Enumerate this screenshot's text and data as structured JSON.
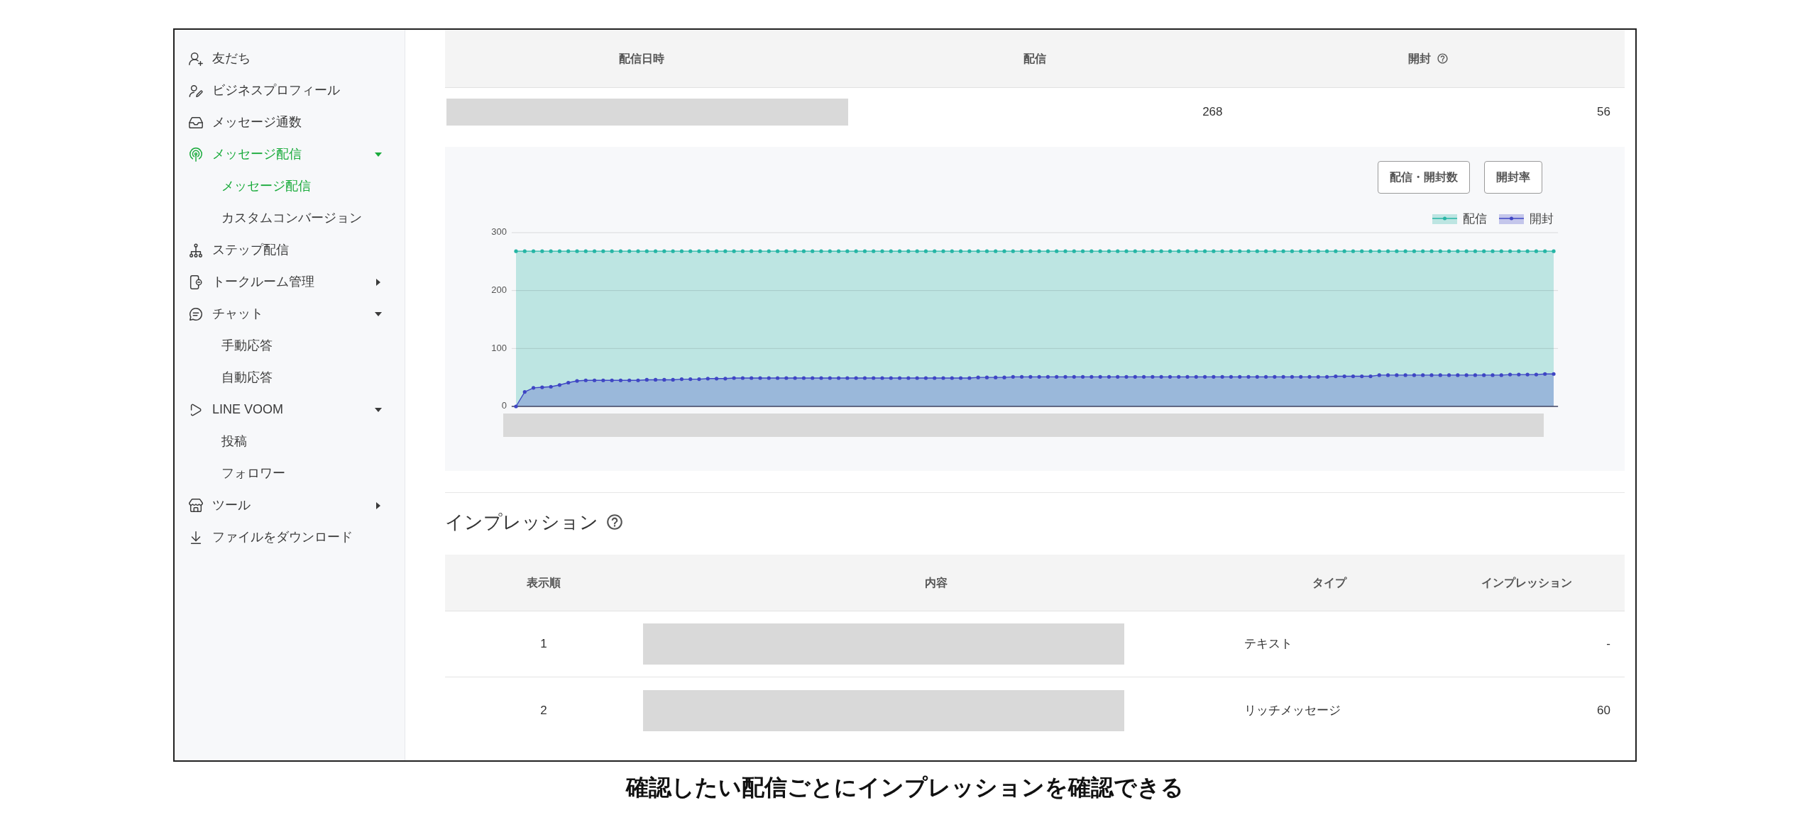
{
  "sidebar": {
    "items": [
      {
        "label": "友だち",
        "selected": false
      },
      {
        "label": "ビジネスプロフィール",
        "selected": false
      },
      {
        "label": "メッセージ通数",
        "selected": false
      },
      {
        "label": "メッセージ配信",
        "selected": true,
        "expanded": true,
        "children": [
          {
            "label": "メッセージ配信",
            "selected": true
          },
          {
            "label": "カスタムコンバージョン",
            "selected": false
          }
        ]
      },
      {
        "label": "ステップ配信",
        "selected": false
      },
      {
        "label": "トークルーム管理",
        "selected": false,
        "expanded": false
      },
      {
        "label": "チャット",
        "selected": false,
        "expanded": true,
        "children": [
          {
            "label": "手動応答",
            "selected": false
          },
          {
            "label": "自動応答",
            "selected": false
          }
        ]
      },
      {
        "label": "LINE VOOM",
        "selected": false,
        "expanded": true,
        "children": [
          {
            "label": "投稿",
            "selected": false
          },
          {
            "label": "フォロワー",
            "selected": false
          }
        ]
      },
      {
        "label": "ツール",
        "selected": false,
        "expanded": false
      },
      {
        "label": "ファイルをダウンロード",
        "selected": false
      }
    ]
  },
  "delivery_table": {
    "columns": [
      {
        "label": "配信日時",
        "help": false
      },
      {
        "label": "配信",
        "help": false
      },
      {
        "label": "開封",
        "help": true
      }
    ],
    "rows": [
      {
        "cells": [
          {
            "kind": "redacted"
          },
          {
            "kind": "text",
            "text": "268"
          },
          {
            "kind": "text",
            "text": "56"
          }
        ]
      }
    ]
  },
  "chart_panel": {
    "buttons": [
      {
        "label": "配信・開封数"
      },
      {
        "label": "開封率"
      }
    ],
    "chart_data": {
      "type": "area",
      "legend": "upper right",
      "categories": [
        null,
        null,
        null,
        null,
        null,
        null,
        null,
        null,
        null,
        null,
        null,
        null,
        null,
        null,
        null,
        null,
        null,
        null,
        null,
        null,
        null,
        null,
        null,
        null,
        null,
        null,
        null,
        null,
        null,
        null,
        null,
        null,
        null,
        null,
        null,
        null,
        null,
        null,
        null,
        null,
        null,
        null,
        null,
        null,
        null,
        null,
        null,
        null,
        null,
        null,
        null,
        null,
        null,
        null,
        null,
        null,
        null,
        null,
        null,
        null,
        null,
        null,
        null,
        null,
        null,
        null,
        null,
        null,
        null,
        null,
        null,
        null,
        null,
        null,
        null,
        null,
        null,
        null,
        null,
        null,
        null,
        null,
        null,
        null,
        null,
        null,
        null,
        null,
        null,
        null,
        null,
        null,
        null,
        null,
        null,
        null,
        null,
        null,
        null,
        null,
        null,
        null,
        null,
        null,
        null,
        null,
        null,
        null,
        null,
        null,
        null,
        null,
        null,
        null,
        null,
        null,
        null,
        null,
        null,
        null
      ],
      "ylim": [
        0,
        300
      ],
      "yticks": [
        0,
        100,
        200,
        300
      ],
      "series": [
        {
          "name": "配信",
          "color": "#26b5a5",
          "values": [
            268,
            268,
            268,
            268,
            268,
            268,
            268,
            268,
            268,
            268,
            268,
            268,
            268,
            268,
            268,
            268,
            268,
            268,
            268,
            268,
            268,
            268,
            268,
            268,
            268,
            268,
            268,
            268,
            268,
            268,
            268,
            268,
            268,
            268,
            268,
            268,
            268,
            268,
            268,
            268,
            268,
            268,
            268,
            268,
            268,
            268,
            268,
            268,
            268,
            268,
            268,
            268,
            268,
            268,
            268,
            268,
            268,
            268,
            268,
            268,
            268,
            268,
            268,
            268,
            268,
            268,
            268,
            268,
            268,
            268,
            268,
            268,
            268,
            268,
            268,
            268,
            268,
            268,
            268,
            268,
            268,
            268,
            268,
            268,
            268,
            268,
            268,
            268,
            268,
            268,
            268,
            268,
            268,
            268,
            268,
            268,
            268,
            268,
            268,
            268,
            268,
            268,
            268,
            268,
            268,
            268,
            268,
            268,
            268,
            268,
            268,
            268,
            268,
            268,
            268,
            268,
            268,
            268,
            268,
            268
          ]
        },
        {
          "name": "開封",
          "color": "#3f46c4",
          "values": [
            0,
            25,
            32,
            33,
            34,
            37,
            41,
            44,
            45,
            45,
            45,
            45,
            45,
            45,
            45,
            46,
            46,
            46,
            46,
            47,
            47,
            47,
            48,
            48,
            48,
            49,
            49,
            49,
            49,
            49,
            49,
            49,
            49,
            49,
            49,
            49,
            49,
            49,
            49,
            49,
            49,
            49,
            49,
            49,
            49,
            49,
            49,
            49,
            49,
            49,
            49,
            49,
            49,
            50,
            50,
            50,
            50,
            51,
            51,
            51,
            51,
            51,
            51,
            51,
            51,
            51,
            51,
            51,
            51,
            51,
            51,
            51,
            51,
            51,
            51,
            51,
            51,
            51,
            51,
            51,
            51,
            51,
            51,
            51,
            51,
            51,
            51,
            51,
            51,
            51,
            51,
            51,
            51,
            51,
            52,
            52,
            52,
            52,
            52,
            54,
            54,
            54,
            54,
            54,
            54,
            54,
            54,
            54,
            54,
            54,
            54,
            54,
            54,
            54,
            55,
            55,
            55,
            55,
            56,
            56
          ]
        }
      ]
    }
  },
  "impressions": {
    "title": "インプレッション",
    "help": true,
    "columns": [
      {
        "label": "表示順"
      },
      {
        "label": "内容"
      },
      {
        "label": "タイプ"
      },
      {
        "label": "インプレッション"
      }
    ],
    "rows": [
      {
        "cells": [
          {
            "kind": "text",
            "text": "1"
          },
          {
            "kind": "redacted"
          },
          {
            "kind": "text",
            "text": "テキスト"
          },
          {
            "kind": "text",
            "text": "-"
          }
        ]
      },
      {
        "cells": [
          {
            "kind": "text",
            "text": "2"
          },
          {
            "kind": "redacted"
          },
          {
            "kind": "text",
            "text": "リッチメッセージ"
          },
          {
            "kind": "text",
            "text": "60"
          }
        ]
      }
    ]
  },
  "caption": "確認したい配信ごとにインプレッションを確認できる"
}
